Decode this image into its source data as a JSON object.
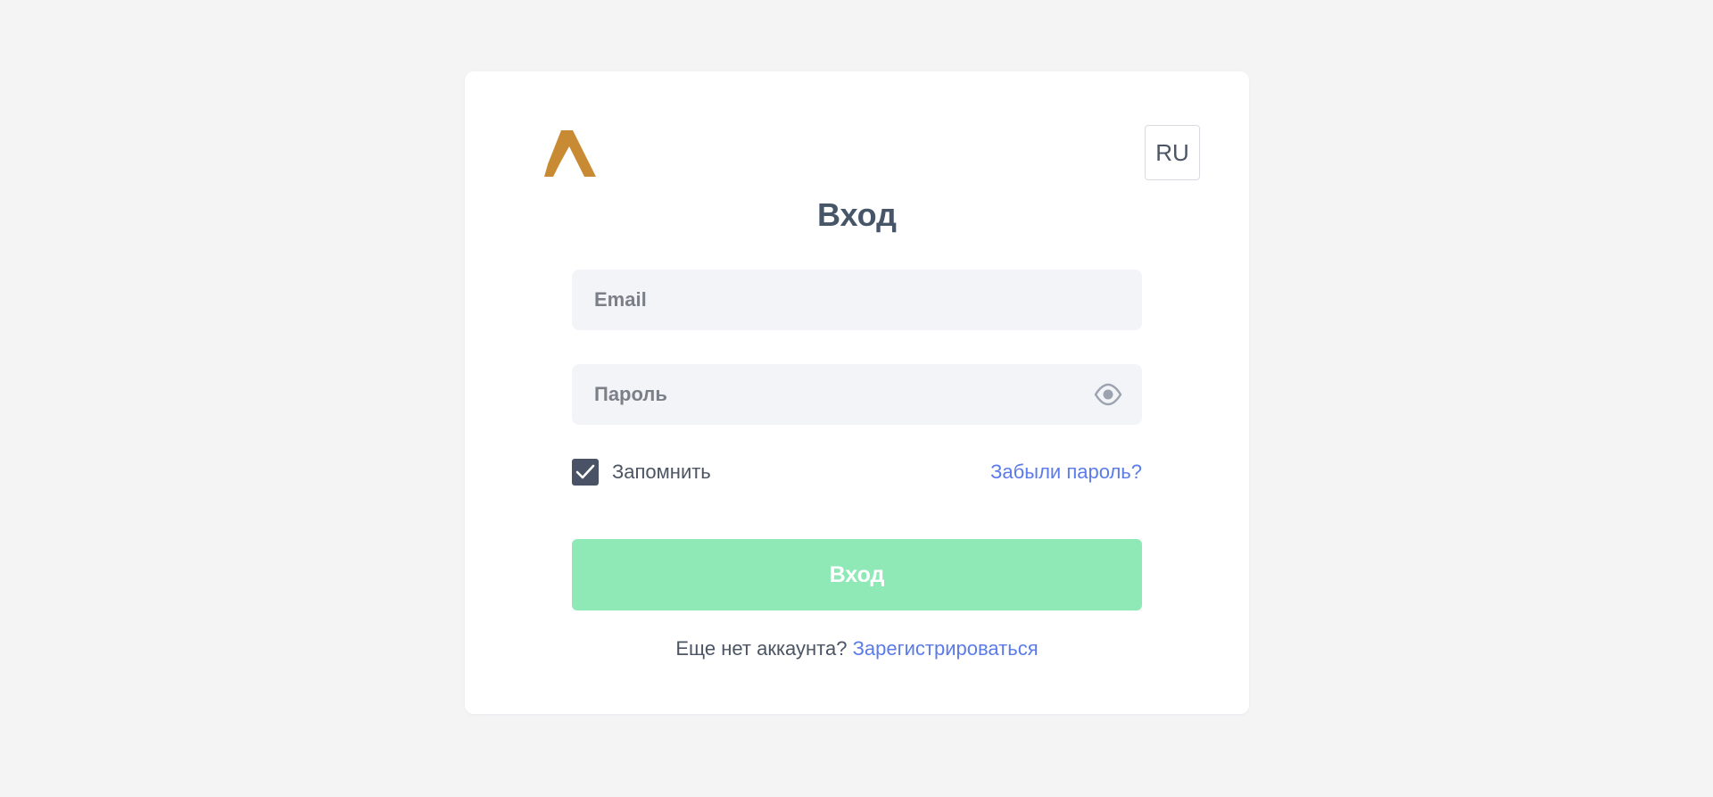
{
  "header": {
    "lang_label": "RU"
  },
  "login": {
    "title": "Вход",
    "email_placeholder": "Email",
    "password_placeholder": "Пароль",
    "remember_label": "Запомнить",
    "remember_checked": true,
    "forgot_link": "Забыли пароль?",
    "submit_label": "Вход",
    "signup_prompt": "Еще нет аккаунта?",
    "signup_link": "Зарегистрироваться"
  },
  "icons": {
    "logo": "brand-logo-icon",
    "password_toggle": "eye-icon",
    "checkbox": "checkmark-icon"
  },
  "colors": {
    "logo": "#c98a34",
    "submit_bg": "#8ee9b7",
    "link": "#5b7be8",
    "checkbox_bg": "#4a5366",
    "input_bg": "#f3f4f8",
    "page_bg": "#f4f4f5"
  }
}
